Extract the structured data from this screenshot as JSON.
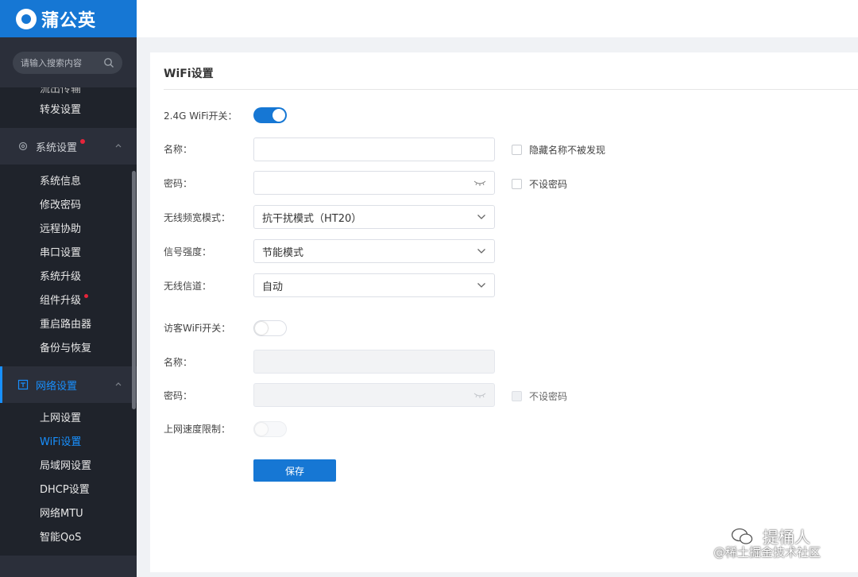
{
  "brand": {
    "name": "蒲公英"
  },
  "sidebar": {
    "search_placeholder": "请输入搜索内容",
    "partial_items": [
      {
        "label": "流出传输"
      },
      {
        "label": "转发设置"
      }
    ],
    "groups": [
      {
        "label": "系统设置",
        "icon": "gear-icon",
        "items": [
          {
            "label": "系统信息"
          },
          {
            "label": "修改密码"
          },
          {
            "label": "远程协助"
          },
          {
            "label": "串口设置"
          },
          {
            "label": "系统升级"
          },
          {
            "label": "组件升级"
          },
          {
            "label": "重启路由器"
          },
          {
            "label": "备份与恢复"
          }
        ]
      },
      {
        "label": "网络设置",
        "icon": "network-icon",
        "items": [
          {
            "label": "上网设置"
          },
          {
            "label": "WiFi设置"
          },
          {
            "label": "局域网设置"
          },
          {
            "label": "DHCP设置"
          },
          {
            "label": "网络MTU"
          },
          {
            "label": "智能QoS"
          }
        ]
      }
    ]
  },
  "page": {
    "title": "WiFi设置",
    "wifi24": {
      "switch_label": "2.4G WiFi开关：",
      "name_label": "名称：",
      "hide_name_label": "隐藏名称不被发现",
      "password_label": "密码：",
      "no_password_label": "不设密码",
      "bandwidth_label": "无线频宽模式：",
      "bandwidth_value": "抗干扰模式（HT20）",
      "signal_label": "信号强度：",
      "signal_value": "节能模式",
      "channel_label": "无线信道：",
      "channel_value": "自动"
    },
    "guest": {
      "switch_label": "访客WiFi开关：",
      "name_label": "名称：",
      "password_label": "密码：",
      "no_password_label": "不设密码",
      "speed_limit_label": "上网速度限制："
    },
    "save_label": "保存"
  },
  "watermark": {
    "line1": "提桶人",
    "line2": "@稀土掘金技术社区"
  },
  "colors": {
    "accent": "#1677d4",
    "sidebar_bg": "#2b2f3a",
    "alert_dot": "#e6243a"
  }
}
